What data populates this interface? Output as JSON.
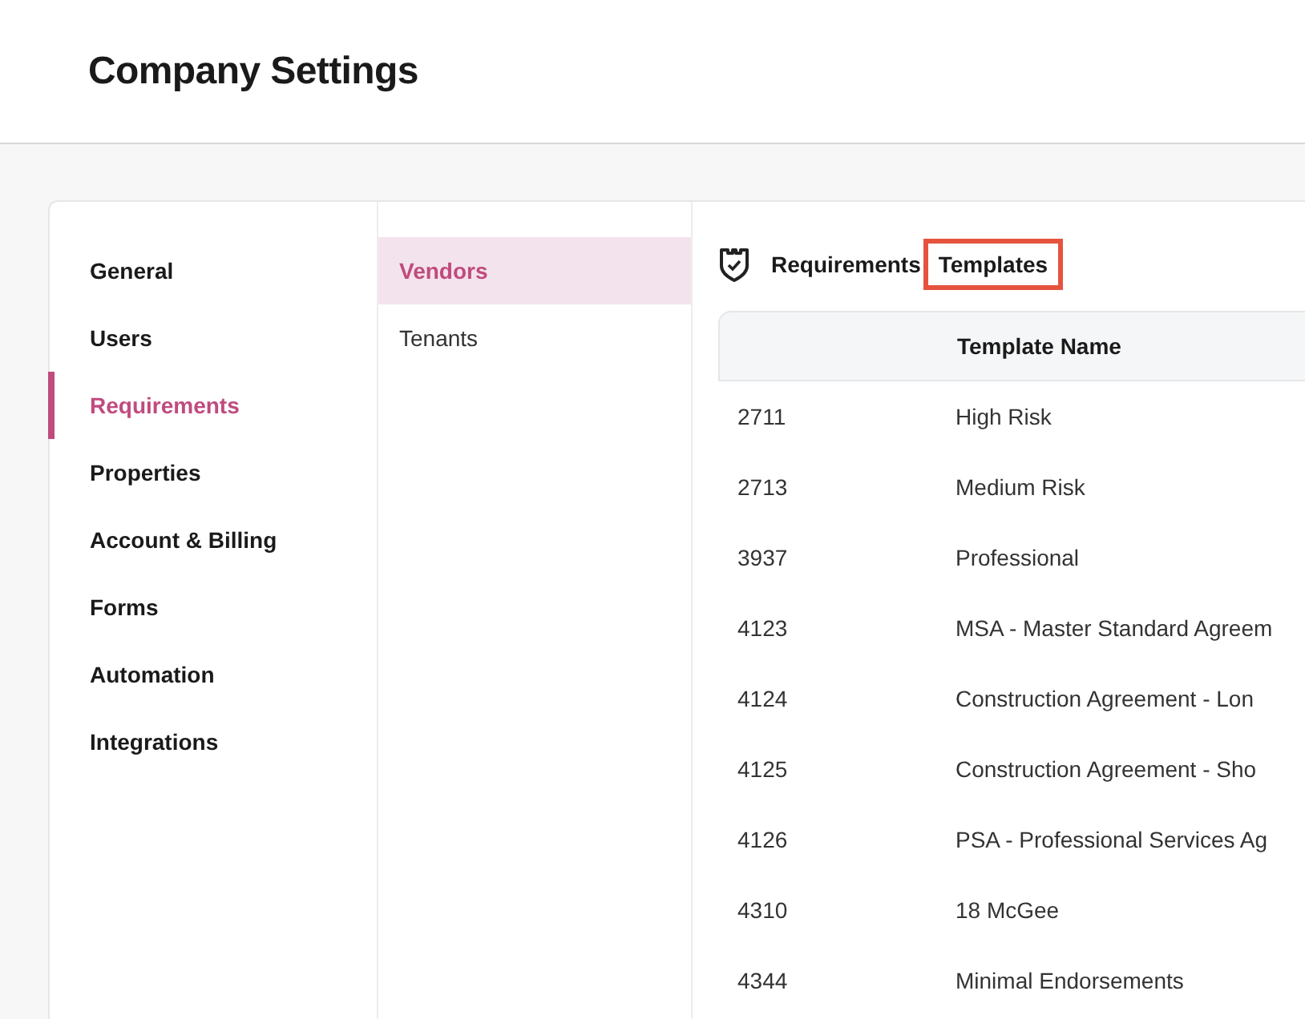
{
  "page": {
    "title": "Company Settings"
  },
  "sidebar": {
    "items": [
      {
        "label": "General",
        "selected": false
      },
      {
        "label": "Users",
        "selected": false
      },
      {
        "label": "Requirements",
        "selected": true
      },
      {
        "label": "Properties",
        "selected": false
      },
      {
        "label": "Account & Billing",
        "selected": false
      },
      {
        "label": "Forms",
        "selected": false
      },
      {
        "label": "Automation",
        "selected": false
      },
      {
        "label": "Integrations",
        "selected": false
      }
    ]
  },
  "subnav": {
    "items": [
      {
        "label": "Vendors",
        "selected": true
      },
      {
        "label": "Tenants",
        "selected": false
      }
    ]
  },
  "content": {
    "title": "Requirements",
    "subtitle": {
      "text": "Templates",
      "highlighted": true
    },
    "table": {
      "columns": [
        "",
        "Template Name"
      ],
      "rows": [
        [
          "2711",
          "High Risk"
        ],
        [
          "2713",
          "Medium Risk"
        ],
        [
          "3937",
          "Professional"
        ],
        [
          "4123",
          "MSA - Master Standard Agreem"
        ],
        [
          "4124",
          "Construction Agreement - Lon"
        ],
        [
          "4125",
          "Construction Agreement - Sho"
        ],
        [
          "4126",
          "PSA - Professional Services Ag"
        ],
        [
          "4310",
          "18 McGee"
        ],
        [
          "4344",
          "Minimal Endorsements"
        ]
      ]
    }
  }
}
